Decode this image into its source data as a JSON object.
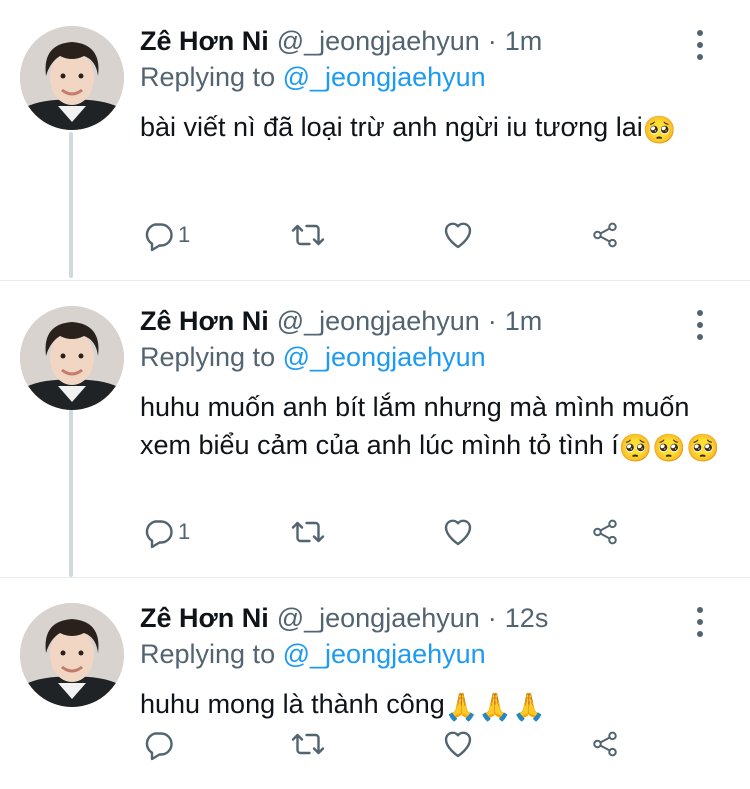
{
  "tweets": [
    {
      "name": "Zê Hơn Ni",
      "handle": "@_jeongjaehyun",
      "separator": "·",
      "time": "1m",
      "replying_prefix": "Replying to",
      "replying_to": "@_jeongjaehyun",
      "text": "bài viết nì đã loại trừ anh ngừi iu tương lai",
      "emojis": [
        "🥺"
      ],
      "reply_count": "1",
      "retweet_count": "",
      "like_count": ""
    },
    {
      "name": "Zê Hơn Ni",
      "handle": "@_jeongjaehyun",
      "separator": "·",
      "time": "1m",
      "replying_prefix": "Replying to",
      "replying_to": "@_jeongjaehyun",
      "text": "huhu muốn anh bít lắm nhưng mà mình muốn xem biểu cảm của anh lúc mình tỏ tình í",
      "emojis": [
        "🥺",
        "🥺",
        "🥺"
      ],
      "reply_count": "1",
      "retweet_count": "",
      "like_count": ""
    },
    {
      "name": "Zê Hơn Ni",
      "handle": "@_jeongjaehyun",
      "separator": "·",
      "time": "12s",
      "replying_prefix": "Replying to",
      "replying_to": "@_jeongjaehyun",
      "text": "huhu mong là thành công",
      "emojis": [
        "🙏",
        "🙏",
        "🙏"
      ],
      "reply_count": "",
      "retweet_count": "",
      "like_count": ""
    }
  ],
  "icons": {
    "reply": "reply-icon",
    "retweet": "retweet-icon",
    "like": "heart-icon",
    "share": "share-icon",
    "more": "more-options-icon"
  },
  "colors": {
    "text": "#0f1419",
    "muted": "#536471",
    "link": "#1d9bf0",
    "thread_line": "#cfd9de",
    "divider": "#e6ecf0"
  }
}
